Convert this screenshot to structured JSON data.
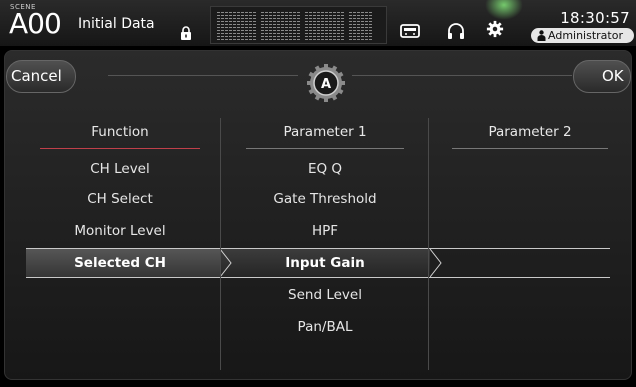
{
  "status_bar": {
    "scene_label": "SCENE",
    "scene_number": "A00",
    "scene_name": "Initial Data",
    "time": "18:30:57",
    "user": "Administrator"
  },
  "dialog": {
    "cancel_label": "Cancel",
    "ok_label": "OK",
    "mode_letter": "A"
  },
  "columns": {
    "function": {
      "header": "Function",
      "items": [
        "CH Level",
        "CH Select",
        "Monitor Level",
        "Selected CH"
      ],
      "selected": "Selected CH",
      "accent_color": "#c0404a"
    },
    "parameter1": {
      "header": "Parameter 1",
      "items": [
        "EQ Q",
        "Gate Threshold",
        "HPF",
        "Input Gain",
        "Send Level",
        "Pan/BAL"
      ],
      "selected": "Input Gain"
    },
    "parameter2": {
      "header": "Parameter 2",
      "items": []
    }
  }
}
